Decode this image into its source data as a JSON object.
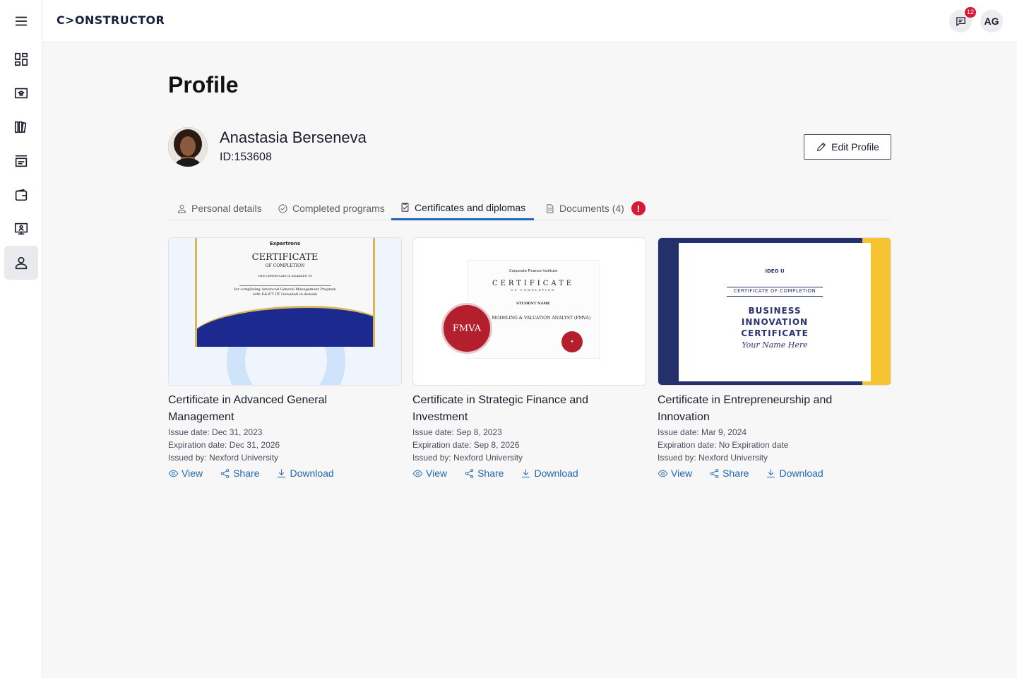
{
  "app": {
    "logo": "C>ONSTRUCTOR",
    "notifications_count": "12",
    "user_initials": "AG"
  },
  "sidebar": {
    "items": [
      {
        "icon": "menu-icon"
      },
      {
        "icon": "dashboard-icon"
      },
      {
        "icon": "learning-icon"
      },
      {
        "icon": "library-icon"
      },
      {
        "icon": "catalog-icon"
      },
      {
        "icon": "wallet-icon"
      },
      {
        "icon": "presentation-icon"
      },
      {
        "icon": "profile-icon",
        "active": true
      }
    ]
  },
  "page": {
    "title": "Profile"
  },
  "user": {
    "name": "Anastasia Berseneva",
    "id": "ID:153608",
    "edit_label": "Edit Profile"
  },
  "tabs": [
    {
      "label": "Personal details",
      "icon": "person-icon"
    },
    {
      "label": "Completed programs",
      "icon": "check-circle-icon"
    },
    {
      "label": "Certificates and diplomas",
      "icon": "certificate-icon",
      "active": true
    },
    {
      "label": "Documents (4)",
      "icon": "document-icon",
      "alert": "!"
    }
  ],
  "actions": {
    "view": "View",
    "share": "Share",
    "download": "Download"
  },
  "certificates": [
    {
      "title": "Certificate in Advanced General Management",
      "issue_date": "Issue date: Dec 31, 2023",
      "expiration_date": "Expiration date: Dec 31, 2026",
      "issued_by": "Issued by: Nexford University",
      "thumb": {
        "brand": "Expertrons",
        "heading": "CERTIFICATE",
        "subheading": "OF COMPLETION",
        "awarded": "THIS CERTIFICATE IS AWARDED TO",
        "line1": "for completing Advanced General Management Program",
        "line2": "with E&ICT IIT Guwahati in domain"
      }
    },
    {
      "title": "Certificate in Strategic Finance and Investment",
      "issue_date": "Issue date: Sep 8, 2023",
      "expiration_date": "Expiration date: Sep 8, 2026",
      "issued_by": "Issued by: Nexford University",
      "thumb": {
        "brand": "Corporate Finance Institute",
        "heading": "CERTIFICATE",
        "subheading": "OF COMPLETION",
        "student": "STUDENT NAME",
        "program": "NCIAL MODELING & VALUATION ANALYST (FMVA)",
        "seal": "FMVA"
      }
    },
    {
      "title": "Certificate in Entrepreneurship and Innovation",
      "issue_date": "Issue date: Mar 9, 2024",
      "expiration_date": "Expiration date: No Expiration date",
      "issued_by": "Issued by: Nexford University",
      "thumb": {
        "brand": "IDEO U",
        "label": "CERTIFICATE OF COMPLETION",
        "heading": "BUSINESS INNOVATION CERTIFICATE",
        "name": "Your Name Here"
      }
    }
  ]
}
